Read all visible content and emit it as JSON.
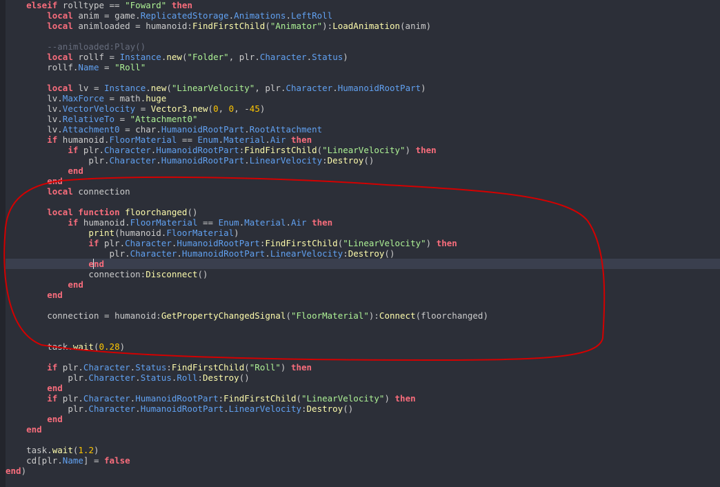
{
  "editor": {
    "current_line": 25,
    "colors": {
      "background": "#2c2f38",
      "current_line": "#3a3f4e",
      "keyword": "#f86d7c",
      "builtin": "#61a1f1",
      "string": "#adf195",
      "number": "#ffc600",
      "method": "#fdfbac",
      "comment": "#666c7c",
      "text": "#cccccc",
      "annotation": "#d40000"
    },
    "lines": [
      [
        [
          4,
          ""
        ],
        [
          "kw",
          "elseif"
        ],
        [
          "txt",
          " rolltype "
        ],
        [
          "op",
          "=="
        ],
        [
          "txt",
          " "
        ],
        [
          "str",
          "\"Foward\""
        ],
        [
          "txt",
          " "
        ],
        [
          "kw",
          "then"
        ]
      ],
      [
        [
          8,
          ""
        ],
        [
          "kw",
          "local"
        ],
        [
          "txt",
          " anim "
        ],
        [
          "op",
          "="
        ],
        [
          "txt",
          " game."
        ],
        [
          "prop",
          "ReplicatedStorage"
        ],
        [
          "txt",
          "."
        ],
        [
          "prop",
          "Animations"
        ],
        [
          "txt",
          "."
        ],
        [
          "prop",
          "LeftRoll"
        ]
      ],
      [
        [
          8,
          ""
        ],
        [
          "kw",
          "local"
        ],
        [
          "txt",
          " animloaded "
        ],
        [
          "op",
          "="
        ],
        [
          "txt",
          " humanoid:"
        ],
        [
          "fn",
          "FindFirstChild"
        ],
        [
          "txt",
          "("
        ],
        [
          "str",
          "\"Animator\""
        ],
        [
          "txt",
          "):"
        ],
        [
          "fn",
          "LoadAnimation"
        ],
        [
          "txt",
          "(anim)"
        ]
      ],
      [
        [
          0,
          ""
        ]
      ],
      [
        [
          8,
          ""
        ],
        [
          "cmt",
          "--animloaded:Play()"
        ]
      ],
      [
        [
          8,
          ""
        ],
        [
          "kw",
          "local"
        ],
        [
          "txt",
          " rollf "
        ],
        [
          "op",
          "="
        ],
        [
          "txt",
          " "
        ],
        [
          "prop",
          "Instance"
        ],
        [
          "txt",
          "."
        ],
        [
          "fn",
          "new"
        ],
        [
          "txt",
          "("
        ],
        [
          "str",
          "\"Folder\""
        ],
        [
          "txt",
          ", plr."
        ],
        [
          "prop",
          "Character"
        ],
        [
          "txt",
          "."
        ],
        [
          "prop",
          "Status"
        ],
        [
          "txt",
          ")"
        ]
      ],
      [
        [
          8,
          ""
        ],
        [
          "txt",
          "rollf."
        ],
        [
          "prop",
          "Name"
        ],
        [
          "txt",
          " "
        ],
        [
          "op",
          "="
        ],
        [
          "txt",
          " "
        ],
        [
          "str",
          "\"Roll\""
        ]
      ],
      [
        [
          0,
          ""
        ]
      ],
      [
        [
          8,
          ""
        ],
        [
          "kw",
          "local"
        ],
        [
          "txt",
          " lv "
        ],
        [
          "op",
          "="
        ],
        [
          "txt",
          " "
        ],
        [
          "prop",
          "Instance"
        ],
        [
          "txt",
          "."
        ],
        [
          "fn",
          "new"
        ],
        [
          "txt",
          "("
        ],
        [
          "str",
          "\"LinearVelocity\""
        ],
        [
          "txt",
          ", plr."
        ],
        [
          "prop",
          "Character"
        ],
        [
          "txt",
          "."
        ],
        [
          "prop",
          "HumanoidRootPart"
        ],
        [
          "txt",
          ")"
        ]
      ],
      [
        [
          8,
          ""
        ],
        [
          "txt",
          "lv."
        ],
        [
          "prop",
          "MaxForce"
        ],
        [
          "txt",
          " "
        ],
        [
          "op",
          "="
        ],
        [
          "txt",
          " math."
        ],
        [
          "fn",
          "huge"
        ]
      ],
      [
        [
          8,
          ""
        ],
        [
          "txt",
          "lv."
        ],
        [
          "prop",
          "VectorVelocity"
        ],
        [
          "txt",
          " "
        ],
        [
          "op",
          "="
        ],
        [
          "txt",
          " "
        ],
        [
          "fn",
          "Vector3"
        ],
        [
          "txt",
          "."
        ],
        [
          "fn",
          "new"
        ],
        [
          "txt",
          "("
        ],
        [
          "num",
          "0"
        ],
        [
          "txt",
          ", "
        ],
        [
          "num",
          "0"
        ],
        [
          "txt",
          ", "
        ],
        [
          "op",
          "-"
        ],
        [
          "num",
          "45"
        ],
        [
          "txt",
          ")"
        ]
      ],
      [
        [
          8,
          ""
        ],
        [
          "txt",
          "lv."
        ],
        [
          "prop",
          "RelativeTo"
        ],
        [
          "txt",
          " "
        ],
        [
          "op",
          "="
        ],
        [
          "txt",
          " "
        ],
        [
          "str",
          "\"Attachment0\""
        ]
      ],
      [
        [
          8,
          ""
        ],
        [
          "txt",
          "lv."
        ],
        [
          "prop",
          "Attachment0"
        ],
        [
          "txt",
          " "
        ],
        [
          "op",
          "="
        ],
        [
          "txt",
          " char."
        ],
        [
          "prop",
          "HumanoidRootPart"
        ],
        [
          "txt",
          "."
        ],
        [
          "prop",
          "RootAttachment"
        ]
      ],
      [
        [
          8,
          ""
        ],
        [
          "kw",
          "if"
        ],
        [
          "txt",
          " humanoid."
        ],
        [
          "prop",
          "FloorMaterial"
        ],
        [
          "txt",
          " "
        ],
        [
          "op",
          "=="
        ],
        [
          "txt",
          " "
        ],
        [
          "prop",
          "Enum"
        ],
        [
          "txt",
          "."
        ],
        [
          "prop",
          "Material"
        ],
        [
          "txt",
          "."
        ],
        [
          "prop",
          "Air"
        ],
        [
          "txt",
          " "
        ],
        [
          "kw",
          "then"
        ]
      ],
      [
        [
          12,
          ""
        ],
        [
          "kw",
          "if"
        ],
        [
          "txt",
          " plr."
        ],
        [
          "prop",
          "Character"
        ],
        [
          "txt",
          "."
        ],
        [
          "prop",
          "HumanoidRootPart"
        ],
        [
          "txt",
          ":"
        ],
        [
          "fn",
          "FindFirstChild"
        ],
        [
          "txt",
          "("
        ],
        [
          "str",
          "\"LinearVelocity\""
        ],
        [
          "txt",
          ") "
        ],
        [
          "kw",
          "then"
        ]
      ],
      [
        [
          16,
          ""
        ],
        [
          "txt",
          "plr."
        ],
        [
          "prop",
          "Character"
        ],
        [
          "txt",
          "."
        ],
        [
          "prop",
          "HumanoidRootPart"
        ],
        [
          "txt",
          "."
        ],
        [
          "prop",
          "LinearVelocity"
        ],
        [
          "txt",
          ":"
        ],
        [
          "fn",
          "Destroy"
        ],
        [
          "txt",
          "()"
        ]
      ],
      [
        [
          12,
          ""
        ],
        [
          "kw",
          "end"
        ]
      ],
      [
        [
          8,
          ""
        ],
        [
          "kw",
          "end"
        ]
      ],
      [
        [
          8,
          ""
        ],
        [
          "kw",
          "local"
        ],
        [
          "txt",
          " connection"
        ]
      ],
      [
        [
          0,
          ""
        ]
      ],
      [
        [
          8,
          ""
        ],
        [
          "kw",
          "local"
        ],
        [
          "txt",
          " "
        ],
        [
          "kw",
          "function"
        ],
        [
          "txt",
          " "
        ],
        [
          "fn",
          "floorchanged"
        ],
        [
          "txt",
          "()"
        ]
      ],
      [
        [
          12,
          ""
        ],
        [
          "kw",
          "if"
        ],
        [
          "txt",
          " humanoid."
        ],
        [
          "prop",
          "FloorMaterial"
        ],
        [
          "txt",
          " "
        ],
        [
          "op",
          "=="
        ],
        [
          "txt",
          " "
        ],
        [
          "prop",
          "Enum"
        ],
        [
          "txt",
          "."
        ],
        [
          "prop",
          "Material"
        ],
        [
          "txt",
          "."
        ],
        [
          "prop",
          "Air"
        ],
        [
          "txt",
          " "
        ],
        [
          "kw",
          "then"
        ]
      ],
      [
        [
          16,
          ""
        ],
        [
          "fn",
          "print"
        ],
        [
          "txt",
          "(humanoid."
        ],
        [
          "prop",
          "FloorMaterial"
        ],
        [
          "txt",
          ")"
        ]
      ],
      [
        [
          16,
          ""
        ],
        [
          "kw",
          "if"
        ],
        [
          "txt",
          " plr."
        ],
        [
          "prop",
          "Character"
        ],
        [
          "txt",
          "."
        ],
        [
          "prop",
          "HumanoidRootPart"
        ],
        [
          "txt",
          ":"
        ],
        [
          "fn",
          "FindFirstChild"
        ],
        [
          "txt",
          "("
        ],
        [
          "str",
          "\"LinearVelocity\""
        ],
        [
          "txt",
          ") "
        ],
        [
          "kw",
          "then"
        ]
      ],
      [
        [
          20,
          ""
        ],
        [
          "txt",
          "plr."
        ],
        [
          "prop",
          "Character"
        ],
        [
          "txt",
          "."
        ],
        [
          "prop",
          "HumanoidRootPart"
        ],
        [
          "txt",
          "."
        ],
        [
          "prop",
          "LinearVelocity"
        ],
        [
          "txt",
          ":"
        ],
        [
          "fn",
          "Destroy"
        ],
        [
          "txt",
          "()"
        ]
      ],
      [
        [
          16,
          ""
        ],
        [
          "kw",
          "end"
        ]
      ],
      [
        [
          16,
          ""
        ],
        [
          "txt",
          "connection:"
        ],
        [
          "fn",
          "Disconnect"
        ],
        [
          "txt",
          "()"
        ]
      ],
      [
        [
          12,
          ""
        ],
        [
          "kw",
          "end"
        ]
      ],
      [
        [
          8,
          ""
        ],
        [
          "kw",
          "end"
        ]
      ],
      [
        [
          0,
          ""
        ]
      ],
      [
        [
          8,
          ""
        ],
        [
          "txt",
          "connection "
        ],
        [
          "op",
          "="
        ],
        [
          "txt",
          " humanoid:"
        ],
        [
          "fn",
          "GetPropertyChangedSignal"
        ],
        [
          "txt",
          "("
        ],
        [
          "str",
          "\"FloorMaterial\""
        ],
        [
          "txt",
          "):"
        ],
        [
          "fn",
          "Connect"
        ],
        [
          "txt",
          "(floorchanged)"
        ]
      ],
      [
        [
          0,
          ""
        ]
      ],
      [
        [
          0,
          ""
        ]
      ],
      [
        [
          8,
          ""
        ],
        [
          "txt",
          "task."
        ],
        [
          "fn",
          "wait"
        ],
        [
          "txt",
          "("
        ],
        [
          "num",
          "0.28"
        ],
        [
          "txt",
          ")"
        ]
      ],
      [
        [
          0,
          ""
        ]
      ],
      [
        [
          8,
          ""
        ],
        [
          "kw",
          "if"
        ],
        [
          "txt",
          " plr."
        ],
        [
          "prop",
          "Character"
        ],
        [
          "txt",
          "."
        ],
        [
          "prop",
          "Status"
        ],
        [
          "txt",
          ":"
        ],
        [
          "fn",
          "FindFirstChild"
        ],
        [
          "txt",
          "("
        ],
        [
          "str",
          "\"Roll\""
        ],
        [
          "txt",
          ") "
        ],
        [
          "kw",
          "then"
        ]
      ],
      [
        [
          12,
          ""
        ],
        [
          "txt",
          "plr."
        ],
        [
          "prop",
          "Character"
        ],
        [
          "txt",
          "."
        ],
        [
          "prop",
          "Status"
        ],
        [
          "txt",
          "."
        ],
        [
          "prop",
          "Roll"
        ],
        [
          "txt",
          ":"
        ],
        [
          "fn",
          "Destroy"
        ],
        [
          "txt",
          "()"
        ]
      ],
      [
        [
          8,
          ""
        ],
        [
          "kw",
          "end"
        ]
      ],
      [
        [
          8,
          ""
        ],
        [
          "kw",
          "if"
        ],
        [
          "txt",
          " plr."
        ],
        [
          "prop",
          "Character"
        ],
        [
          "txt",
          "."
        ],
        [
          "prop",
          "HumanoidRootPart"
        ],
        [
          "txt",
          ":"
        ],
        [
          "fn",
          "FindFirstChild"
        ],
        [
          "txt",
          "("
        ],
        [
          "str",
          "\"LinearVelocity\""
        ],
        [
          "txt",
          ") "
        ],
        [
          "kw",
          "then"
        ]
      ],
      [
        [
          12,
          ""
        ],
        [
          "txt",
          "plr."
        ],
        [
          "prop",
          "Character"
        ],
        [
          "txt",
          "."
        ],
        [
          "prop",
          "HumanoidRootPart"
        ],
        [
          "txt",
          "."
        ],
        [
          "prop",
          "LinearVelocity"
        ],
        [
          "txt",
          ":"
        ],
        [
          "fn",
          "Destroy"
        ],
        [
          "txt",
          "()"
        ]
      ],
      [
        [
          8,
          ""
        ],
        [
          "kw",
          "end"
        ]
      ],
      [
        [
          4,
          ""
        ],
        [
          "kw",
          "end"
        ]
      ],
      [
        [
          0,
          ""
        ]
      ],
      [
        [
          4,
          ""
        ],
        [
          "txt",
          "task."
        ],
        [
          "fn",
          "wait"
        ],
        [
          "txt",
          "("
        ],
        [
          "num",
          "1.2"
        ],
        [
          "txt",
          ")"
        ]
      ],
      [
        [
          4,
          ""
        ],
        [
          "txt",
          "cd[plr."
        ],
        [
          "prop",
          "Name"
        ],
        [
          "txt",
          "] "
        ],
        [
          "op",
          "="
        ],
        [
          "txt",
          " "
        ],
        [
          "kw",
          "false"
        ]
      ],
      [
        [
          0,
          ""
        ],
        [
          "kw",
          "end"
        ],
        [
          "txt",
          ")"
        ]
      ]
    ]
  }
}
